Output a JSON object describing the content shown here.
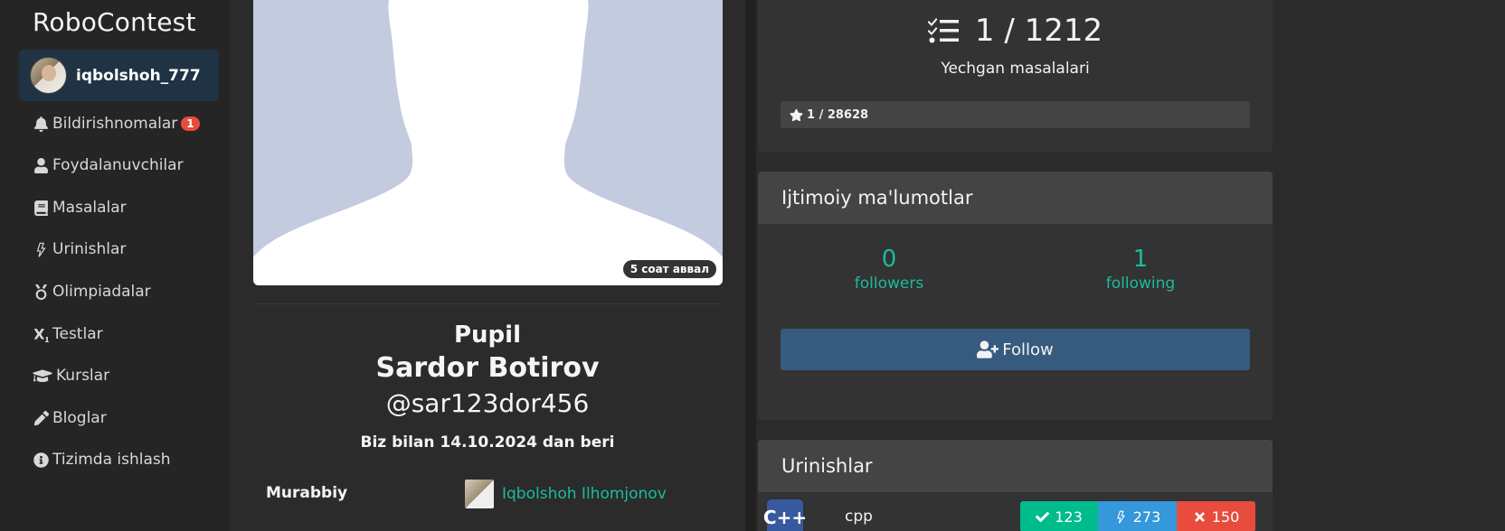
{
  "sidebar": {
    "brand": "RoboContest",
    "user": {
      "username": "iqbolshoh_777"
    },
    "items": [
      {
        "label": "Bildirishnomalar",
        "icon": "bell-icon",
        "badge": "1"
      },
      {
        "label": "Foydalanuvchilar",
        "icon": "user-icon"
      },
      {
        "label": "Masalalar",
        "icon": "book-icon"
      },
      {
        "label": "Urinishlar",
        "icon": "bolt-icon"
      },
      {
        "label": "Olimpiadalar",
        "icon": "medal-icon"
      },
      {
        "label": "Testlar",
        "icon": "subscript-icon"
      },
      {
        "label": "Kurslar",
        "icon": "graduation-cap-icon"
      },
      {
        "label": "Bloglar",
        "icon": "pen-icon"
      },
      {
        "label": "Tizimda ishlash",
        "icon": "info-icon"
      }
    ]
  },
  "profile": {
    "photo_time": "5 соат аввал",
    "rank": "Pupil",
    "full_name": "Sardor Botirov",
    "handle": "@sar123dor456",
    "since": "Biz bilan 14.10.2024 dan beri",
    "coach_label": "Murabbiy",
    "coach_name": "Iqbolshoh Ilhomjonov"
  },
  "stats": {
    "solved": "1 / 1212",
    "solved_label": "Yechgan masalalari",
    "rating": "1 / 28628"
  },
  "social": {
    "title": "Ijtimoiy ma'lumotlar",
    "followers_count": "0",
    "followers_label": "followers",
    "following_count": "1",
    "following_label": "following",
    "follow_button": "Follow"
  },
  "attempts": {
    "title": "Urinishlar",
    "lang_icon": "C++",
    "lang_name": "cpp",
    "accepted": "123",
    "attempted": "273",
    "failed": "150"
  },
  "colors": {
    "accent": "#1abc9c",
    "primary": "#375a7f",
    "success": "#00bc8c",
    "info": "#3498db",
    "danger": "#e74c3c"
  }
}
